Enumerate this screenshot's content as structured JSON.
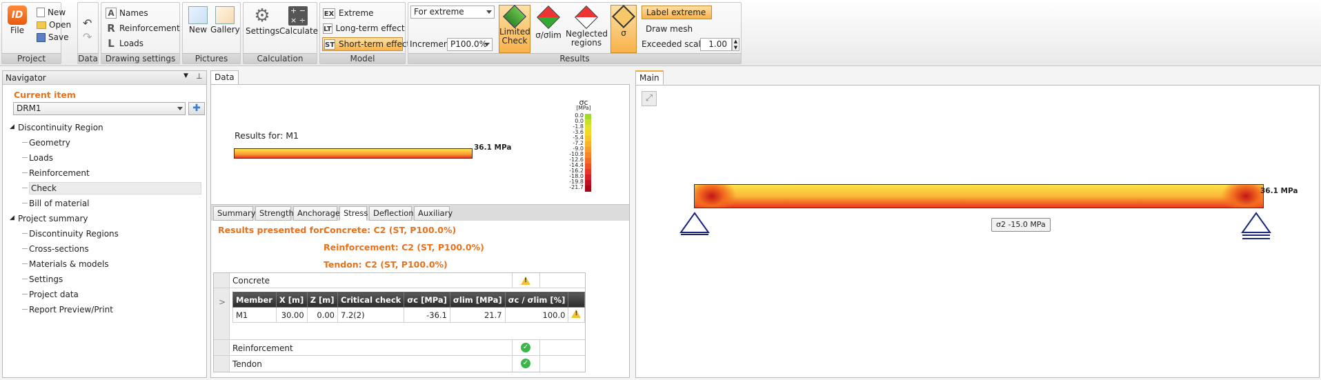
{
  "ribbon": {
    "project": {
      "label": "Project",
      "file": "File",
      "new": "New",
      "open": "Open",
      "save": "Save"
    },
    "data": {
      "label": "Data"
    },
    "drawing": {
      "label": "Drawing settings",
      "names": "Names",
      "reinforcement": "Reinforcement",
      "loads": "Loads"
    },
    "pictures": {
      "label": "Pictures",
      "new": "New",
      "gallery": "Gallery"
    },
    "calculation": {
      "label": "Calculation",
      "settings": "Settings",
      "calculate": "Calculate"
    },
    "model": {
      "label": "Model",
      "extreme": "Extreme",
      "long_term": "Long-term effect",
      "short_term": "Short-term effect",
      "tag_ex": "EX",
      "tag_lt": "LT",
      "tag_st": "ST"
    },
    "results": {
      "label": "Results",
      "for_extreme": "For extreme",
      "increment_label": "Increment",
      "increment_value": "P100.0%",
      "limited_check": "Limited Check",
      "sigma_ratio": "σ/σlim",
      "neglected": "Neglected regions",
      "sigma": "σ",
      "label_extreme": "Label extreme",
      "draw_mesh": "Draw mesh",
      "exceeded_scale_label": "Exceeded scale",
      "exceeded_scale_value": "1.00"
    }
  },
  "navigator": {
    "title": "Navigator",
    "current_item": "Current item",
    "selected": "DRM1",
    "tree": [
      {
        "label": "Discontinuity Region",
        "level": 0
      },
      {
        "label": "Geometry",
        "level": 1
      },
      {
        "label": "Loads",
        "level": 1
      },
      {
        "label": "Reinforcement",
        "level": 1
      },
      {
        "label": "Check",
        "level": 1,
        "selected": true
      },
      {
        "label": "Bill of material",
        "level": 1
      },
      {
        "label": "Project summary",
        "level": 0
      },
      {
        "label": "Discontinuity Regions",
        "level": 1
      },
      {
        "label": "Cross-sections",
        "level": 1
      },
      {
        "label": "Materials & models",
        "level": 1
      },
      {
        "label": "Settings",
        "level": 1
      },
      {
        "label": "Project data",
        "level": 1
      },
      {
        "label": "Report Preview/Print",
        "level": 1
      }
    ]
  },
  "data_panel": {
    "tab": "Data",
    "results_for": "Results for: M1",
    "max_label": "36.1 MPa",
    "legend_title": "σc",
    "legend_unit": "[MPa]",
    "legend_values": [
      "0.0",
      "0.0",
      "-1.8",
      "-3.6",
      "-5.4",
      "-7.2",
      "-9.0",
      "-10.8",
      "-12.6",
      "-14.4",
      "-16.2",
      "-18.0",
      "-19.8",
      "-21.7"
    ],
    "legend_colors": [
      "#a5d82a",
      "#c8e02a",
      "#e5e02a",
      "#f2d72a",
      "#f7c52a",
      "#f9b02a",
      "#f99a2a",
      "#f8822a",
      "#f4692a",
      "#ee4f2a",
      "#e4362a",
      "#d4202a",
      "#bf1020",
      "#a50618"
    ],
    "tabs": [
      "Summary",
      "Strength",
      "Anchorage",
      "Stress",
      "Deflection",
      "Auxiliary"
    ],
    "active_tab": "Stress",
    "presented_for": "Results presented for:",
    "concrete_line": "Concrete: C2 (ST, P100.0%)",
    "reinforcement_line": "Reinforcement: C2 (ST, P100.0%)",
    "tendon_line": "Tendon: C2 (ST, P100.0%)",
    "groups": {
      "concrete": "Concrete",
      "reinforcement": "Reinforcement",
      "tendon": "Tendon"
    },
    "expander": ">",
    "columns": [
      "Member",
      "X [m]",
      "Z [m]",
      "Critical check",
      "σc [MPa]",
      "σlim [MPa]",
      "σc / σlim [%]"
    ],
    "row": {
      "member": "M1",
      "x": "30.00",
      "z": "0.00",
      "check": "7.2(2)",
      "sc": "-36.1",
      "slim": "21.7",
      "ratio": "100.0"
    }
  },
  "main_panel": {
    "tab": "Main",
    "max_label": "36.1 MPa",
    "sigma_label": "σ2 -15.0 MPa"
  }
}
